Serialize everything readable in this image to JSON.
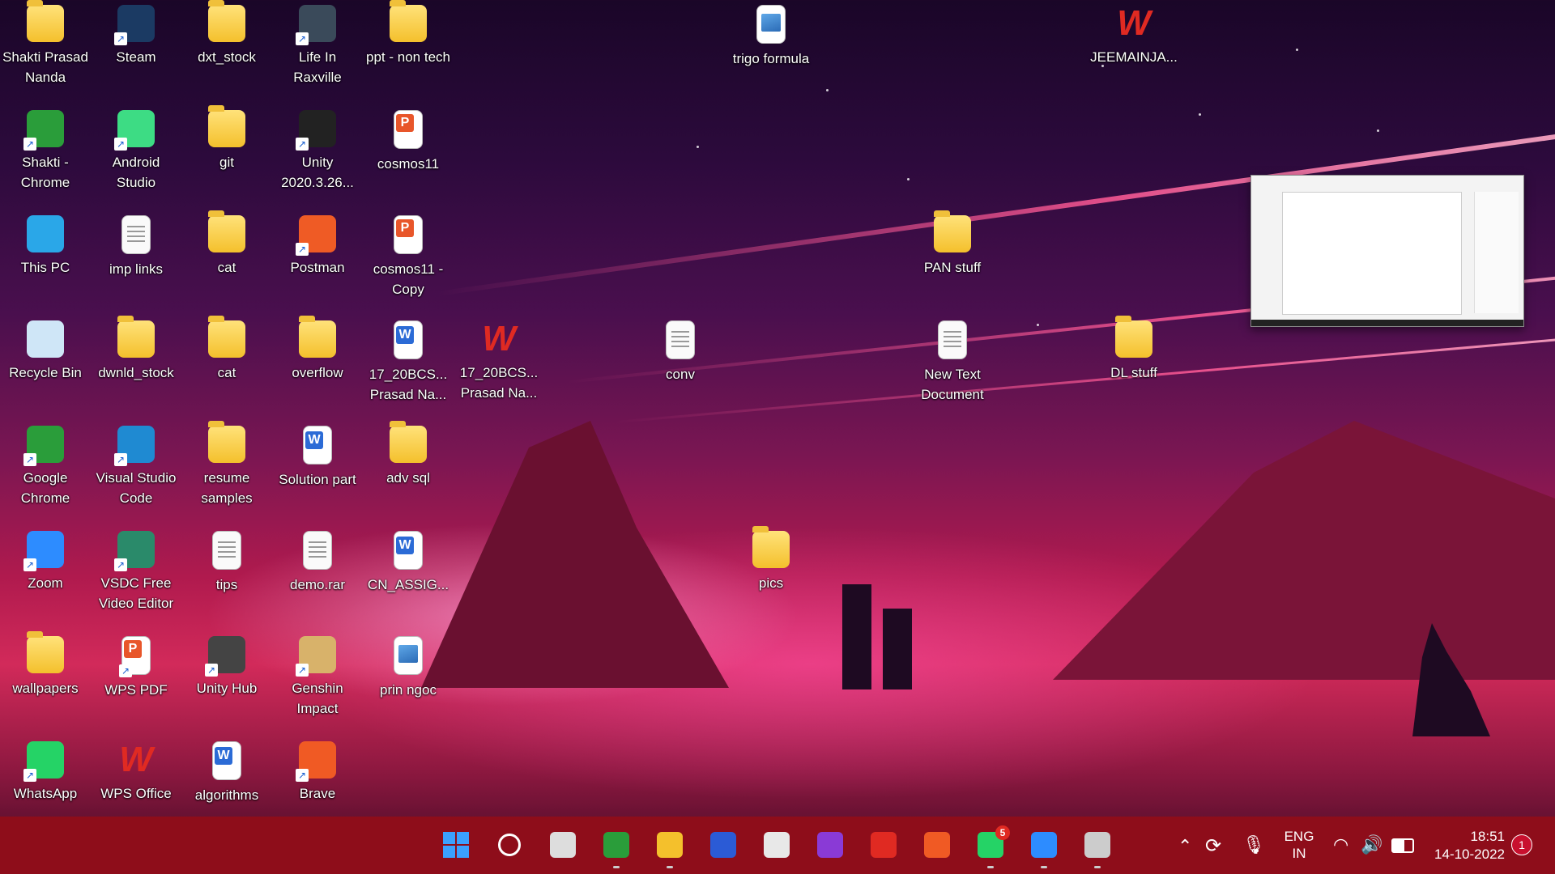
{
  "desktop": {
    "icons": [
      {
        "label": "Shakti Prasad Nanda",
        "icon": "folder-icon"
      },
      {
        "label": "Steam",
        "icon": "steam-icon"
      },
      {
        "label": "dxt_stock",
        "icon": "folder-icon"
      },
      {
        "label": "Life In Raxville",
        "icon": "game-icon"
      },
      {
        "label": "ppt - non tech",
        "icon": "folder-icon"
      },
      {
        "label": "trigo formula",
        "icon": "image-file-icon"
      },
      {
        "label": "JEEMAINJA...",
        "icon": "wps-icon"
      },
      {
        "label": "Shakti - Chrome",
        "icon": "chrome-icon"
      },
      {
        "label": "Android Studio",
        "icon": "android-studio-icon"
      },
      {
        "label": "git",
        "icon": "folder-icon"
      },
      {
        "label": "Unity 2020.3.26...",
        "icon": "unity-icon"
      },
      {
        "label": "cosmos11",
        "icon": "pdf-file-icon"
      },
      {
        "label": "This PC",
        "icon": "computer-icon"
      },
      {
        "label": "imp links",
        "icon": "text-file-icon"
      },
      {
        "label": "cat",
        "icon": "folder-icon"
      },
      {
        "label": "Postman",
        "icon": "postman-icon"
      },
      {
        "label": "cosmos11 - Copy",
        "icon": "pdf-file-icon"
      },
      {
        "label": "PAN stuff",
        "icon": "folder-icon"
      },
      {
        "label": "Recycle Bin",
        "icon": "recycle-bin-icon"
      },
      {
        "label": "dwnld_stock",
        "icon": "folder-icon"
      },
      {
        "label": "cat",
        "icon": "folder-icon"
      },
      {
        "label": "overflow",
        "icon": "folder-icon"
      },
      {
        "label": "17_20BCS... Prasad Na...",
        "icon": "word-file-icon"
      },
      {
        "label": "17_20BCS... Prasad Na...",
        "icon": "wps-icon"
      },
      {
        "label": "conv",
        "icon": "text-file-icon"
      },
      {
        "label": "New Text Document",
        "icon": "text-file-icon"
      },
      {
        "label": "DL stuff",
        "icon": "folder-icon"
      },
      {
        "label": "Google Chrome",
        "icon": "chrome-icon"
      },
      {
        "label": "Visual Studio Code",
        "icon": "vscode-icon"
      },
      {
        "label": "resume samples",
        "icon": "folder-icon"
      },
      {
        "label": "Solution part",
        "icon": "word-file-icon"
      },
      {
        "label": "adv sql",
        "icon": "folder-icon"
      },
      {
        "label": "Zoom",
        "icon": "zoom-icon"
      },
      {
        "label": "VSDC Free Video Editor",
        "icon": "vsdc-icon"
      },
      {
        "label": "tips",
        "icon": "text-file-icon"
      },
      {
        "label": "demo.rar",
        "icon": "blank-file-icon"
      },
      {
        "label": "CN_ASSIG...",
        "icon": "word-file-icon"
      },
      {
        "label": "pics",
        "icon": "folder-icon"
      },
      {
        "label": "wallpapers",
        "icon": "folder-icon"
      },
      {
        "label": "WPS PDF",
        "icon": "wps-pdf-icon"
      },
      {
        "label": "Unity Hub",
        "icon": "unity-hub-icon"
      },
      {
        "label": "Genshin Impact",
        "icon": "genshin-icon"
      },
      {
        "label": "prin ngoc",
        "icon": "image-file-icon"
      },
      {
        "label": "WhatsApp",
        "icon": "whatsapp-icon"
      },
      {
        "label": "WPS Office",
        "icon": "wps-icon"
      },
      {
        "label": "algorithms",
        "icon": "word-file-icon"
      },
      {
        "label": "Brave",
        "icon": "brave-icon"
      }
    ]
  },
  "taskbar": {
    "apps": [
      {
        "name": "start-button",
        "icon": "windows-start-icon",
        "color": "#3aa0ff"
      },
      {
        "name": "search-button",
        "icon": "search-icon",
        "color": "#ffffff"
      },
      {
        "name": "task-view-button",
        "icon": "task-view-icon",
        "color": "#dddddd"
      },
      {
        "name": "chrome-button",
        "icon": "chrome-icon",
        "color": "#2a9d3a"
      },
      {
        "name": "file-explorer-button",
        "icon": "folder-icon",
        "color": "#f4c02c"
      },
      {
        "name": "app-button-a",
        "icon": "editor-icon",
        "color": "#2b5bd6"
      },
      {
        "name": "snipping-tool-button",
        "icon": "snipping-tool-icon",
        "color": "#e8e8e8"
      },
      {
        "name": "app-button-b",
        "icon": "media-icon",
        "color": "#8a3ad6"
      },
      {
        "name": "wps-button",
        "icon": "wps-icon",
        "color": "#e02a22"
      },
      {
        "name": "brave-button",
        "icon": "brave-icon",
        "color": "#f05a24"
      },
      {
        "name": "whatsapp-button",
        "icon": "whatsapp-icon",
        "color": "#25d366",
        "badge": "5"
      },
      {
        "name": "zoom-button",
        "icon": "zoom-icon",
        "color": "#2d8cff"
      },
      {
        "name": "settings-button",
        "icon": "gear-icon",
        "color": "#cccccc"
      }
    ],
    "tray": {
      "language_top": "ENG",
      "language_bottom": "IN",
      "time": "18:51",
      "date": "14-10-2022",
      "notification_count": "1"
    }
  }
}
